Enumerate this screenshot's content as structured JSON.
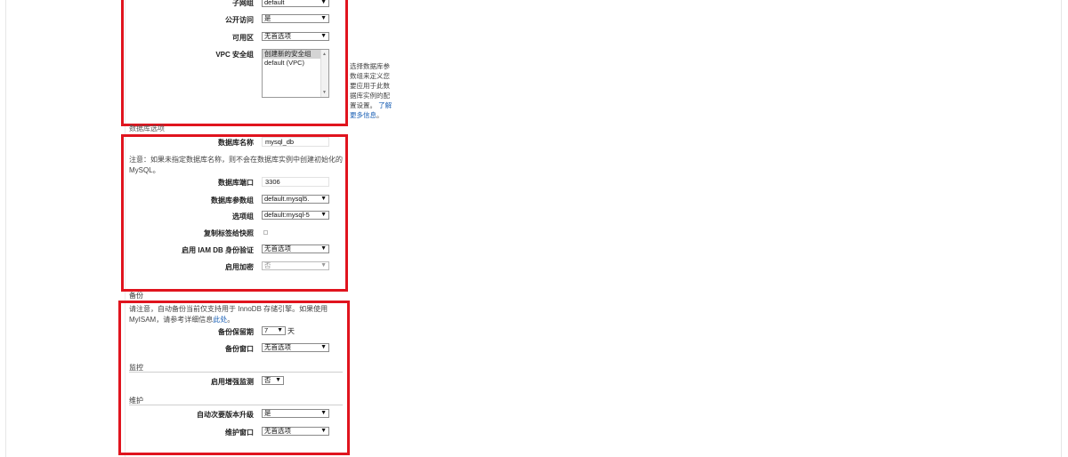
{
  "network": {
    "subnet_group_label": "子网组",
    "subnet_group_value": "default",
    "public_access_label": "公开访问",
    "public_access_value": "是",
    "availability_zone_label": "可用区",
    "availability_zone_value": "无首选项",
    "vpc_sg_label": "VPC 安全组",
    "vpc_sg_options": [
      "创建新的安全组",
      "default (VPC)"
    ],
    "help_text": [
      "选择数据库参",
      "数组来定义您",
      "要应用于此数",
      "据库实例的配",
      "置设置。"
    ],
    "help_link_1": "了解",
    "help_link_2": "更多信息",
    "help_tail": "。"
  },
  "db_options": {
    "section_title": "数据库选项",
    "db_name_label": "数据库名称",
    "db_name_value": "mysql_db",
    "note": "注意：如果未指定数据库名称，则不会在数据库实例中创建初始化的 MySQL。",
    "port_label": "数据库端口",
    "port_value": "3306",
    "param_group_label": "数据库参数组",
    "param_group_value": "default.mysql5.",
    "option_group_label": "选项组",
    "option_group_value": "default:mysql-5",
    "copy_tags_label": "复制标签给快照",
    "iam_auth_label": "启用 IAM DB 身份验证",
    "iam_auth_value": "无首选项",
    "encryption_label": "启用加密",
    "encryption_value": "否"
  },
  "backup": {
    "section_title": "备份",
    "note_pre": "请注意，自动备份当前仅支持用于 InnoDB 存储引擎。如果使用 MyISAM，请参考详细信息",
    "note_link": "此处",
    "note_post": "。",
    "retention_label": "备份保留期",
    "retention_value": "7",
    "retention_unit": "天",
    "window_label": "备份窗口",
    "window_value": "无首选项"
  },
  "monitoring": {
    "section_title": "监控",
    "enhanced_label": "启用增强监测",
    "enhanced_value": "否"
  },
  "maintenance": {
    "section_title": "维护",
    "auto_upgrade_label": "自动次要版本升级",
    "auto_upgrade_value": "是",
    "window_label": "维护窗口",
    "window_value": "无首选项"
  },
  "colors": {
    "highlight_border": "#e0141e",
    "link": "#1a5fb4"
  }
}
